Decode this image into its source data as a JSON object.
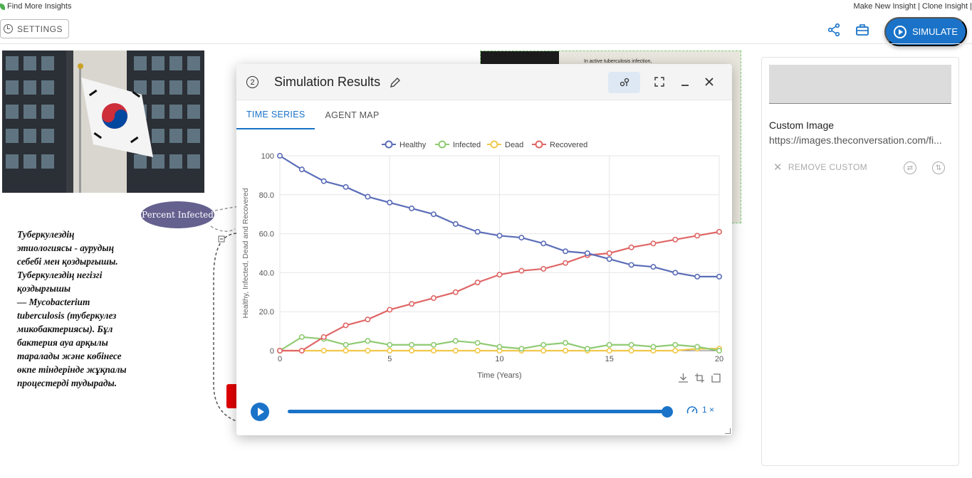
{
  "topbar": {
    "find_insights": "Find More Insights",
    "links": "Make New Insight | Clone Insight | "
  },
  "toolbar": {
    "settings_label": "SETTINGS",
    "simulate_label": "SIMULATE"
  },
  "canvas": {
    "node_label": "Percent Infected",
    "text_block": "Туберкулездің\nэтиологиясы - аурудың\nсебебі мен қоздырғышы.\nТуберкулездің негізгі\nқоздырғышы\n— Mycobacterium\ntuberculosis (туберкулез\nмикобактериясы). Бұл\nбактерия ауа арқылы\nтаралады және көбінесе\nөкпе тіндерінде жұқпалы\nпроцестерді тудырады.",
    "image_caption": "In active tuberculosis infection,"
  },
  "right_panel": {
    "title": "Custom Image",
    "url": "https://images.theconversation.com/fi...",
    "remove_label": "REMOVE CUSTOM"
  },
  "simulation": {
    "title": "Simulation Results",
    "help_number": "2",
    "tabs": [
      "TIME SERIES",
      "AGENT MAP"
    ],
    "active_tab": 0,
    "speed": "1 ×",
    "progress": 1.0
  },
  "colors": {
    "accent": "#1a73c8",
    "healthy": "#5b6db8",
    "infected": "#8fca72",
    "dead": "#f2c84b",
    "recovered": "#e06666"
  },
  "chart_data": {
    "type": "line",
    "xlabel": "Time (Years)",
    "ylabel": "Healthy, Infected, Dead and Recovered",
    "xlim": [
      0,
      20
    ],
    "ylim": [
      0,
      100
    ],
    "x_ticks": [
      "0",
      "5",
      "10",
      "15",
      "20"
    ],
    "y_ticks": [
      "0",
      "20.0",
      "40.0",
      "60.0",
      "80.0",
      "100"
    ],
    "grid": true,
    "legend_position": "top",
    "x": [
      0,
      1,
      2,
      3,
      4,
      5,
      6,
      7,
      8,
      9,
      10,
      11,
      12,
      13,
      14,
      15,
      16,
      17,
      18,
      19,
      20
    ],
    "series": [
      {
        "name": "Healthy",
        "color": "#5b6db8",
        "values": [
          100,
          93,
          87,
          84,
          79,
          76,
          73,
          70,
          65,
          61,
          59,
          58,
          55,
          51,
          50,
          47,
          44,
          43,
          40,
          38,
          38
        ]
      },
      {
        "name": "Infected",
        "color": "#8fca72",
        "values": [
          0,
          7,
          6,
          3,
          5,
          3,
          3,
          3,
          5,
          4,
          2,
          1,
          3,
          4,
          1,
          3,
          3,
          2,
          3,
          2,
          0
        ]
      },
      {
        "name": "Dead",
        "color": "#f2c84b",
        "values": [
          0,
          0,
          0,
          0,
          0,
          0,
          0,
          0,
          0,
          0,
          0,
          0,
          0,
          0,
          0,
          0,
          0,
          0,
          0,
          1,
          1
        ]
      },
      {
        "name": "Recovered",
        "color": "#e06666",
        "values": [
          0,
          0,
          7,
          13,
          16,
          21,
          24,
          27,
          30,
          35,
          39,
          41,
          42,
          45,
          49,
          50,
          53,
          55,
          57,
          59,
          61
        ]
      }
    ]
  }
}
